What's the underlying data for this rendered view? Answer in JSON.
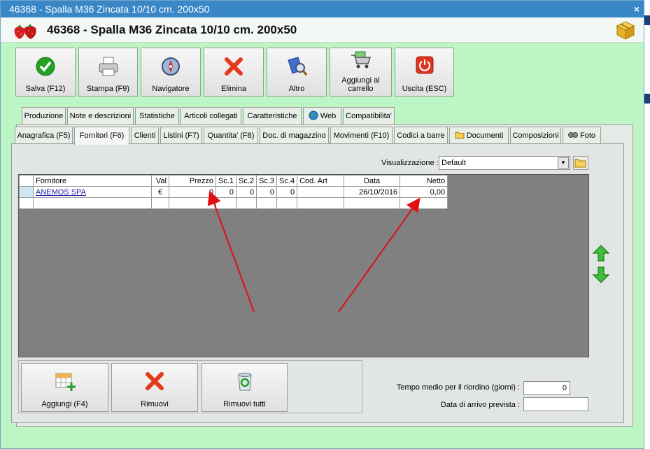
{
  "window": {
    "title": "46368 - Spalla M36 Zincata 10/10 cm. 200x50",
    "close_glyph": "×"
  },
  "header": {
    "title": "46368 - Spalla M36 Zincata 10/10 cm. 200x50",
    "logo_icon": "strawberry-icon",
    "box_icon": "package-icon"
  },
  "toolbar": {
    "save": "Salva (F12)",
    "print": "Stampa (F9)",
    "navigator": "Navigatore",
    "delete": "Elimina",
    "other": "Altro",
    "add_cart_line1": "Aggiungi al",
    "add_cart_line2": "carrello",
    "exit": "Uscita (ESC)"
  },
  "tabs_top": [
    "Produzione",
    "Note e descrizioni",
    "Statistiche",
    "Articoli collegati",
    "Caratteristiche",
    "Web",
    "Compatibilita'"
  ],
  "tabs_bottom": [
    "Anagrafica (F5)",
    "Fornitori (F6)",
    "Clienti",
    "Listini (F7)",
    "Quantita' (F8)",
    "Doc. di magazzino",
    "Movimenti (F10)",
    "Codici a barre",
    "Documenti",
    "Composizioni",
    "Foto"
  ],
  "active_tab": "Fornitori (F6)",
  "view": {
    "label": "Visualizzazione :",
    "value": "Default",
    "dropdown_glyph": "▼"
  },
  "grid": {
    "columns": [
      "Fornitore",
      "Val",
      "Prezzo",
      "Sc.1",
      "Sc.2",
      "Sc.3",
      "Sc.4",
      "Cod. Art",
      "Data",
      "Netto"
    ],
    "rows": [
      {
        "supplier": "ANEMOS SPA",
        "currency": "€",
        "price": "0",
        "sc1": "0",
        "sc2": "0",
        "sc3": "0",
        "sc4": "0",
        "code": "",
        "date": "26/10/2016",
        "net": "0,00"
      }
    ]
  },
  "bottom_buttons": {
    "add": "Aggiungi (F4)",
    "remove": "Rimuovi",
    "remove_all": "Rimuovi tutti"
  },
  "fields": {
    "reorder_label": "Tempo medio per il riordino (giorni) :",
    "reorder_value": "0",
    "arrival_label": "Data di arrivo prevista :",
    "arrival_value": ""
  },
  "colors": {
    "window_bg": "#bef5c4",
    "titlebar": "#3a87c7",
    "grid_bg": "#808080",
    "annotation_arrow": "#e01010"
  }
}
